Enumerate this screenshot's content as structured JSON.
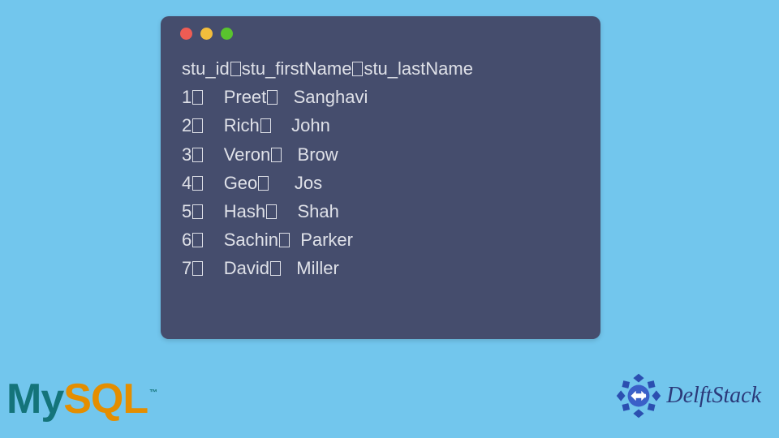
{
  "terminal": {
    "header": {
      "col1": "stu_id",
      "col2": "stu_firstName",
      "col3": "stu_lastName"
    },
    "rows": [
      {
        "id": "1",
        "first": "Preet",
        "last": "Sanghavi"
      },
      {
        "id": "2",
        "first": "Rich",
        "last": "John"
      },
      {
        "id": "3",
        "first": "Veron",
        "last": "Brow"
      },
      {
        "id": "4",
        "first": "Geo",
        "last": "Jos"
      },
      {
        "id": "5",
        "first": "Hash",
        "last": "Shah"
      },
      {
        "id": "6",
        "first": "Sachin",
        "last": "Parker"
      },
      {
        "id": "7",
        "first": "David",
        "last": "Miller"
      }
    ]
  },
  "logos": {
    "mysql_my": "My",
    "mysql_sql": "SQL",
    "mysql_tm": "™",
    "delftstack": "DelftStack"
  },
  "colors": {
    "page_bg": "#72c6ed",
    "terminal_bg": "#454d6d",
    "terminal_fg": "#dfe1e8",
    "dot_red": "#ee5c54",
    "dot_yellow": "#f2be3c",
    "dot_green": "#59c42e",
    "mysql_teal": "#14747a",
    "mysql_orange": "#e48e00",
    "delft_blue": "#2b3a7a"
  },
  "chart_data": {
    "type": "table",
    "title": "",
    "columns": [
      "stu_id",
      "stu_firstName",
      "stu_lastName"
    ],
    "rows": [
      [
        1,
        "Preet",
        "Sanghavi"
      ],
      [
        2,
        "Rich",
        "John"
      ],
      [
        3,
        "Veron",
        "Brow"
      ],
      [
        4,
        "Geo",
        "Jos"
      ],
      [
        5,
        "Hash",
        "Shah"
      ],
      [
        6,
        "Sachin",
        "Parker"
      ],
      [
        7,
        "David",
        "Miller"
      ]
    ]
  }
}
